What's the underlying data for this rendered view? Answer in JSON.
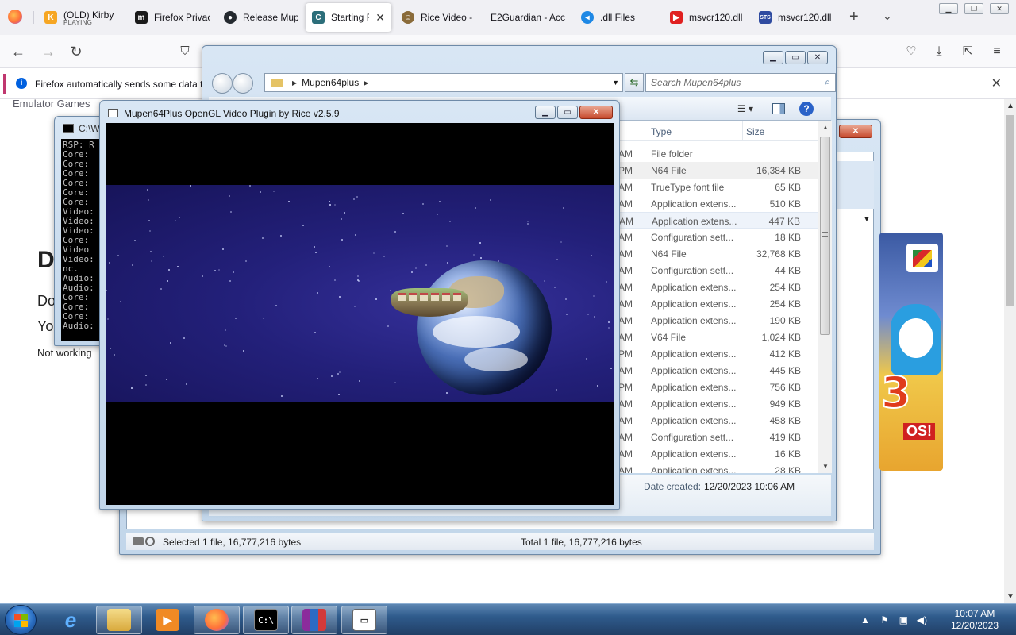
{
  "browser": {
    "tabs": [
      {
        "title": "(OLD) Kirby",
        "subtitle": "PLAYING",
        "favicon": "kirby-icon",
        "color": "#f6a623"
      },
      {
        "title": "Firefox Privac",
        "favicon": "m-icon",
        "color": "#1a1a1a"
      },
      {
        "title": "Release Mup",
        "favicon": "github-icon",
        "color": "#24292f"
      },
      {
        "title": "Starting R",
        "favicon": "c-icon",
        "color": "#2c6e7a",
        "active": true
      },
      {
        "title": "Rice Video -",
        "favicon": "rice-icon",
        "color": "#8a6b3a"
      },
      {
        "title": "E2Guardian - Acc",
        "favicon": "blank-icon",
        "color": "#ffffff"
      },
      {
        "title": ".dll Files",
        "favicon": "dll-icon",
        "color": "#1e88e5"
      },
      {
        "title": "msvcr120.dll",
        "favicon": "youtube-icon",
        "color": "#e02020"
      },
      {
        "title": "msvcr120.dll",
        "favicon": "sts-icon",
        "color": "#2f4ba0"
      }
    ],
    "notice": "Firefox automatically sends some data to"
  },
  "page": {
    "breadcrumb": "Emulator Games",
    "heading": "D",
    "line1": "Do",
    "line2": "Yo",
    "line3": "Not working"
  },
  "explorer": {
    "path": "Mupen64plus",
    "search_placeholder": "Search Mupen64plus",
    "columns": {
      "type": "Type",
      "size": "Size"
    },
    "files": [
      {
        "time": "AM",
        "type": "File folder",
        "size": ""
      },
      {
        "time": "PM",
        "type": "N64 File",
        "size": "16,384 KB",
        "selected": true
      },
      {
        "time": "AM",
        "type": "TrueType font file",
        "size": "65 KB"
      },
      {
        "time": "AM",
        "type": "Application extens...",
        "size": "510 KB"
      },
      {
        "time": "AM",
        "type": "Application extens...",
        "size": "447 KB",
        "hover": true
      },
      {
        "time": "AM",
        "type": "Configuration sett...",
        "size": "18 KB"
      },
      {
        "time": "AM",
        "type": "N64 File",
        "size": "32,768 KB"
      },
      {
        "time": "AM",
        "type": "Configuration sett...",
        "size": "44 KB"
      },
      {
        "time": "AM",
        "type": "Application extens...",
        "size": "254 KB"
      },
      {
        "time": "AM",
        "type": "Application extens...",
        "size": "254 KB"
      },
      {
        "time": "AM",
        "type": "Application extens...",
        "size": "190 KB"
      },
      {
        "time": "AM",
        "type": "V64 File",
        "size": "1,024 KB"
      },
      {
        "time": "PM",
        "type": "Application extens...",
        "size": "412 KB"
      },
      {
        "time": "AM",
        "type": "Application extens...",
        "size": "445 KB"
      },
      {
        "time": "PM",
        "type": "Application extens...",
        "size": "756 KB"
      },
      {
        "time": "AM",
        "type": "Application extens...",
        "size": "949 KB"
      },
      {
        "time": "AM",
        "type": "Application extens...",
        "size": "458 KB"
      },
      {
        "time": "AM",
        "type": "Configuration sett...",
        "size": "419 KB"
      },
      {
        "time": "AM",
        "type": "Application extens...",
        "size": "16 KB"
      },
      {
        "time": "AM",
        "type": "Application extens...",
        "size": "28 KB"
      }
    ],
    "date_created_label": "Date created:",
    "date_created": "12/20/2023 10:06 AM"
  },
  "bg_explorer": {
    "status_selected": "Selected 1 file, 16,777,216 bytes",
    "status_total": "Total 1 file, 16,777,216 bytes"
  },
  "boxart": {
    "number": "3",
    "tagline": "OS!"
  },
  "console": {
    "title": "C:\\W",
    "lines": "RSP: R\nCore:\nCore:\nCore:\nCore:\nCore:\nCore:\nVideo:\nVideo:\nVideo:\nCore:\nVideo\nVideo:\nnc.\nAudio:\nAudio:\nCore:\nCore:\nCore:\nAudio:"
  },
  "rice": {
    "title": "Mupen64Plus OpenGL Video Plugin by Rice v2.5.9"
  },
  "taskbar": {
    "time": "10:07 AM",
    "date": "12/20/2023"
  }
}
